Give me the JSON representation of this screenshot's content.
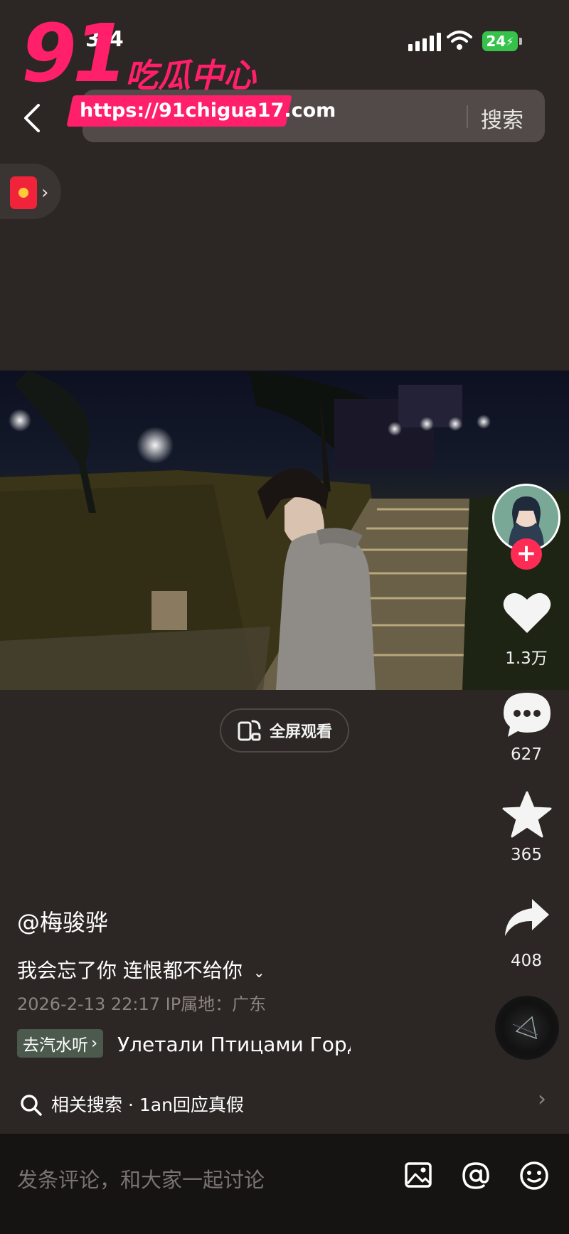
{
  "status_bar": {
    "time": "3:4",
    "battery": "24"
  },
  "watermark": {
    "logo_number": "91",
    "logo_text": "吃瓜中心",
    "url": "https://91chigua17.com"
  },
  "top_bar": {
    "search_button": "搜索"
  },
  "video": {
    "fullscreen_label": "全屏观看"
  },
  "actions": {
    "likes": "1.3万",
    "comments": "627",
    "favorites": "365",
    "shares": "408"
  },
  "post": {
    "author": "@梅骏骅",
    "caption": "我会忘了你 连恨都不给你",
    "meta": "2026-2-13 22:17  IP属地：广东",
    "music_tag": "去汽水听",
    "music_title": "Улетали Птицами Горд"
  },
  "related": {
    "text": "相关搜索 · 1an回应真假"
  },
  "comment_bar": {
    "placeholder": "发条评论，和大家一起讨论"
  },
  "colors": {
    "accent": "#fe2c55",
    "watermark": "#ff1f6b",
    "battery": "#36c24a",
    "background": "#2c2624"
  }
}
